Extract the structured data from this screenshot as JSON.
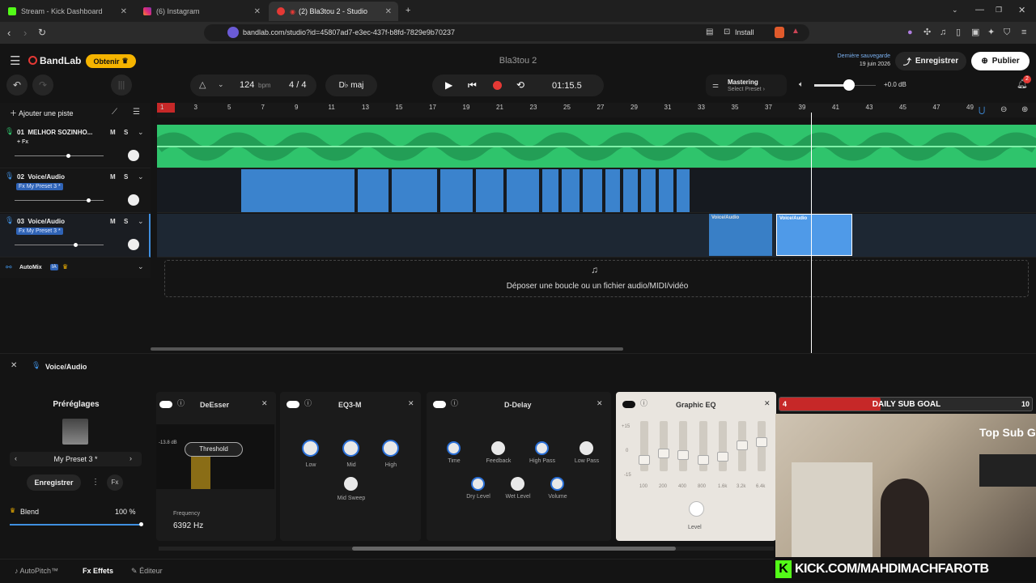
{
  "browser": {
    "tabs": [
      {
        "title": "Stream - Kick Dashboard"
      },
      {
        "title": "(6) Instagram"
      },
      {
        "title": "(2) Bla3tou 2 - Studio"
      }
    ],
    "url": "bandlab.com/studio?id=45807ad7-e3ec-437f-b8fd-7829e9b70237",
    "install_label": "Install"
  },
  "header": {
    "brand": "BandLab",
    "obtain": "Obtenir",
    "project_title": "Bla3tou 2",
    "last_saved_label": "Dernière sauvegarde",
    "last_saved_date": "19 juin 2026",
    "save_label": "Enregistrer",
    "publish_label": "Publier"
  },
  "toolbar": {
    "bpm_value": "124",
    "bpm_unit": "bpm",
    "ts_num": "4",
    "ts_sep": "/",
    "ts_den": "4",
    "key": "D♭ maj",
    "time": "01:15.5",
    "mastering_title": "Mastering",
    "mastering_sub": "Select Preset ›",
    "volume": "+0.0 dB",
    "notif_count": "2"
  },
  "tracks_panel": {
    "add_track": "Ajouter une piste",
    "tracks": [
      {
        "num": "01",
        "name": "MELHOR SOZINHO...",
        "fx": "+ Fx",
        "m": "M",
        "s": "S"
      },
      {
        "num": "02",
        "name": "Voice/Audio",
        "fx": "Fx My Preset 3 *",
        "m": "M",
        "s": "S"
      },
      {
        "num": "03",
        "name": "Voice/Audio",
        "fx": "Fx My Preset 3 *",
        "m": "M",
        "s": "S"
      }
    ],
    "automix": "AutoMix",
    "ia": "IA"
  },
  "ruler": [
    "1",
    "3",
    "5",
    "7",
    "9",
    "11",
    "13",
    "15",
    "17",
    "19",
    "21",
    "23",
    "25",
    "27",
    "29",
    "31",
    "33",
    "35",
    "37",
    "39",
    "41",
    "43",
    "45",
    "47",
    "49"
  ],
  "clips": {
    "track3_a": "Voice/Audio",
    "track3_b": "Voice/Audio"
  },
  "drop_zone": "Déposer une boucle ou un fichier audio/MIDI/vidéo",
  "effects_panel": {
    "title": "Voice/Audio",
    "presets_title": "Préréglages",
    "preset_name": "My Preset 3 *",
    "save_label": "Enregistrer",
    "blend_label": "Blend",
    "blend_value": "100 %",
    "deesser": {
      "title": "DeEsser",
      "threshold_label": "Threshold",
      "db": "-13.8 dB",
      "freq_label": "Frequency",
      "freq_value": "6392 Hz"
    },
    "eq3": {
      "title": "EQ3-M",
      "low": "Low",
      "mid": "Mid",
      "high": "High",
      "mid_sweep": "Mid Sweep"
    },
    "delay": {
      "title": "D-Delay",
      "time": "Time",
      "feedback": "Feedback",
      "high_pass": "High Pass",
      "low_pass": "Low Pass",
      "dry": "Dry Level",
      "wet": "Wet Level",
      "volume": "Volume"
    },
    "geq": {
      "title": "Graphic EQ",
      "scale": [
        "+15",
        "0",
        "-15"
      ],
      "bands": [
        "100",
        "200",
        "400",
        "800",
        "1.6k",
        "3.2k",
        "6.4k"
      ],
      "level": "Level"
    }
  },
  "bottom_tabs": {
    "autopitch": "AutoPitch™",
    "effects": "Effets",
    "fx": "Fx",
    "editor": "Éditeur"
  },
  "stream_overlay": {
    "goal_title": "DAILY SUB GOAL",
    "goal_current": "4",
    "goal_target": "10",
    "goal_progress": 0.4,
    "top_sub": "Top Sub G",
    "kick_url": "KICK.COM/MAHDIMACHFAROTB"
  },
  "colors": {
    "green_track": "#2fc46c",
    "blue_track": "#3f8fe0",
    "record": "#e53935",
    "obtain": "#f5b400",
    "kick": "#53fc18"
  }
}
